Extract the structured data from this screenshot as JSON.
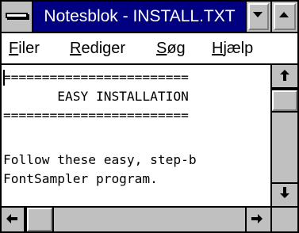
{
  "window": {
    "title": "Notesblok - INSTALL.TXT",
    "title_bar_color": "#000080",
    "face_color": "#c0c0c0"
  },
  "icons": {
    "system_menu": "system-menu-icon",
    "minimize": "triangle-down-icon",
    "maximize": "triangle-up-icon",
    "scroll_up": "arrow-up-icon",
    "scroll_down": "arrow-down-icon",
    "scroll_left": "arrow-left-icon",
    "scroll_right": "arrow-right-icon"
  },
  "menu": {
    "items": [
      {
        "accel": "F",
        "rest": "iler"
      },
      {
        "accel": "R",
        "rest": "ediger"
      },
      {
        "accel": "S",
        "rest": "øg"
      },
      {
        "accel": "H",
        "rest": "jælp"
      }
    ]
  },
  "document": {
    "lines": [
      "========================",
      "       EASY INSTALLATION",
      "========================",
      "",
      "Follow these easy, step-b",
      "FontSampler program."
    ]
  }
}
